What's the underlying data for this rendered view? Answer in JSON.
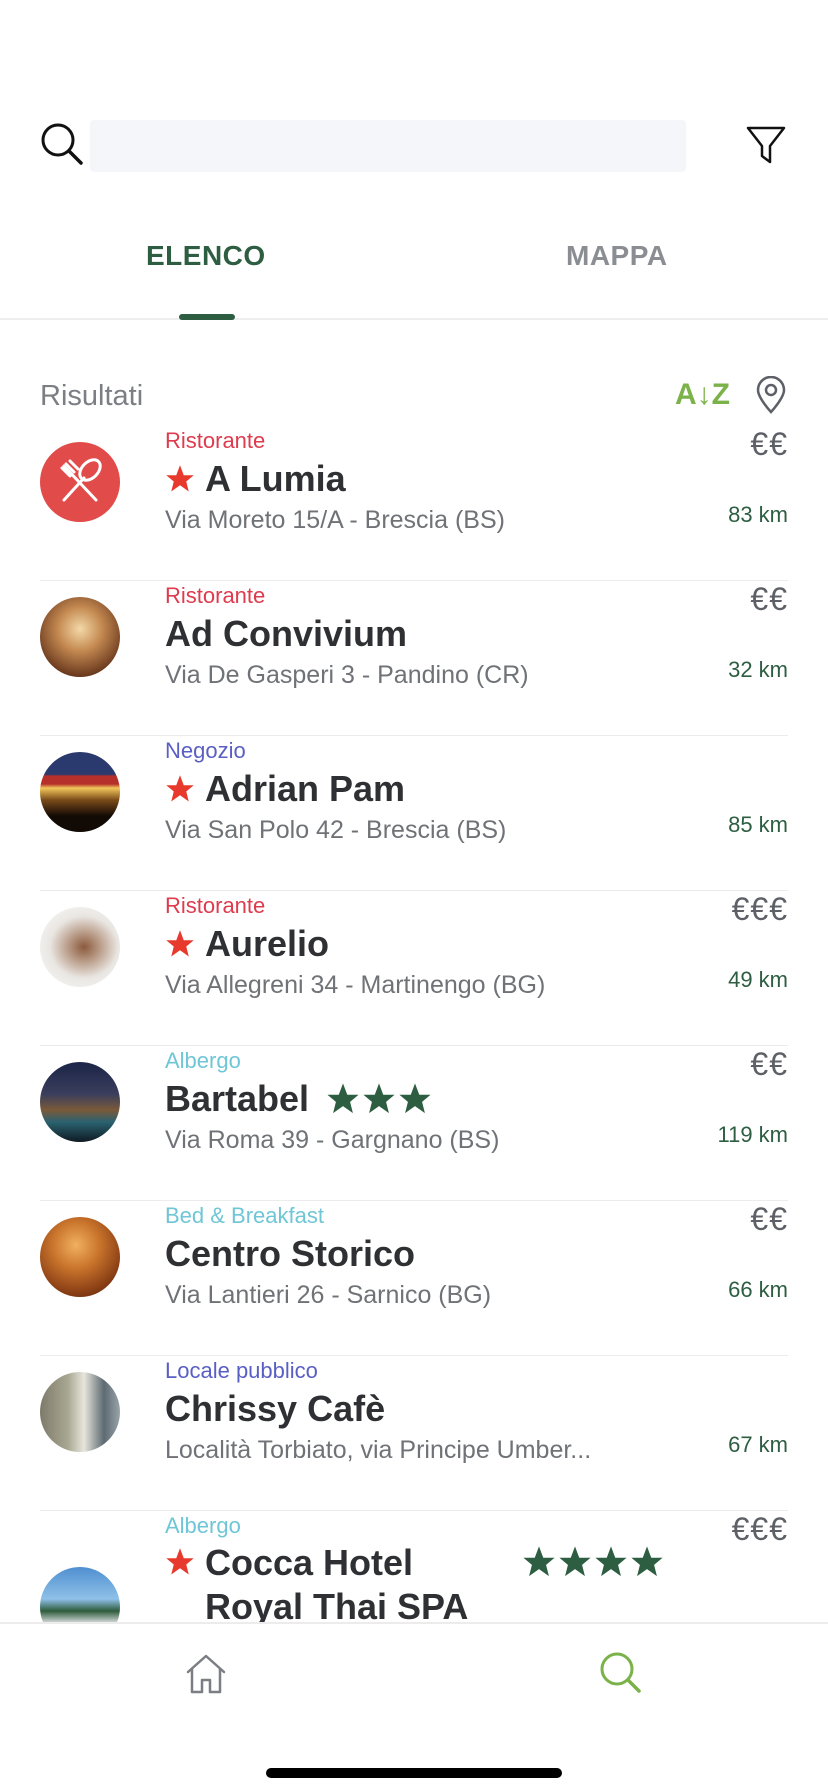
{
  "search": {
    "value": "",
    "placeholder": ""
  },
  "tabs": [
    {
      "label": "ELENCO",
      "active": true
    },
    {
      "label": "MAPPA",
      "active": false
    }
  ],
  "results": {
    "label": "Risultati",
    "sort_label": "A↓Z"
  },
  "items": [
    {
      "category": "Ristorante",
      "category_type": "ristorante",
      "name": "A Lumia",
      "featured": true,
      "stars": 0,
      "address": "Via Moreto 15/A - Brescia (BS)",
      "price": "€€",
      "distance": "83 km",
      "avatar": "restaurant-logo"
    },
    {
      "category": "Ristorante",
      "category_type": "ristorante",
      "name": "Ad Convivium",
      "featured": false,
      "stars": 0,
      "address": "Via De Gasperi 3 - Pandino (CR)",
      "price": "€€",
      "distance": "32 km",
      "avatar": "photo"
    },
    {
      "category": "Negozio",
      "category_type": "negozio",
      "name": "Adrian Pam",
      "featured": true,
      "stars": 0,
      "address": "Via San Polo 42 - Brescia (BS)",
      "price": "",
      "distance": "85 km",
      "avatar": "photo"
    },
    {
      "category": "Ristorante",
      "category_type": "ristorante",
      "name": "Aurelio",
      "featured": true,
      "stars": 0,
      "address": "Via Allegreni 34 - Martinengo (BG)",
      "price": "€€€",
      "distance": "49 km",
      "avatar": "photo"
    },
    {
      "category": "Albergo",
      "category_type": "albergo",
      "name": "Bartabel",
      "featured": false,
      "stars": 3,
      "address": "Via Roma 39 - Gargnano (BS)",
      "price": "€€",
      "distance": "119 km",
      "avatar": "photo"
    },
    {
      "category": "Bed & Breakfast",
      "category_type": "bnb",
      "name": "Centro Storico",
      "featured": false,
      "stars": 0,
      "address": "Via Lantieri 26 - Sarnico (BG)",
      "price": "€€",
      "distance": "66 km",
      "avatar": "photo"
    },
    {
      "category": "Locale pubblico",
      "category_type": "locale",
      "name": "Chrissy Cafè",
      "featured": false,
      "stars": 0,
      "address": "Località Torbiato, via Principe Umber...",
      "price": "",
      "distance": "67 km",
      "avatar": "photo"
    },
    {
      "category": "Albergo",
      "category_type": "albergo",
      "name": "Cocca Hotel Royal Thai SPA",
      "featured": true,
      "stars": 4,
      "address": "",
      "price": "€€€",
      "distance": "",
      "avatar": "photo"
    }
  ],
  "colors": {
    "primary_green": "#2e5e42",
    "sort_green": "#7bb24a",
    "ristorante": "#de3b4d",
    "negozio": "#5a5fc4",
    "albergo": "#6fc6d6",
    "featured_star": "#e83a2c"
  },
  "nav": {
    "home_icon": "home-icon",
    "search_icon": "search-icon",
    "active": "search"
  }
}
